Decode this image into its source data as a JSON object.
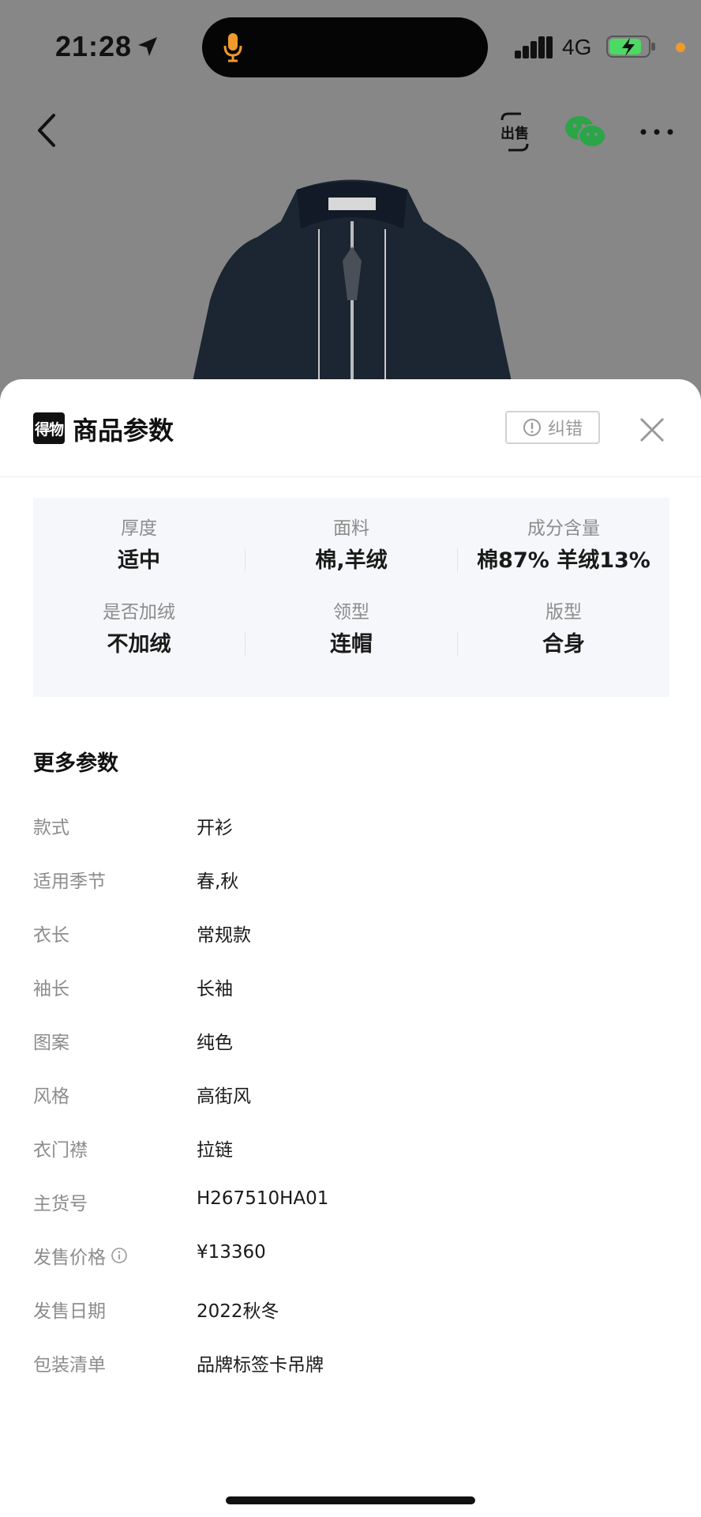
{
  "status_bar": {
    "time": "21:28",
    "network": "4G"
  },
  "nav": {
    "back_icon": "chevron-left-icon",
    "sell_label": "出售",
    "share_icon": "wechat-icon",
    "more_icon": "more-dots-icon"
  },
  "sheet": {
    "brand_logo_text": "得物",
    "title": "商品参数",
    "report_label": "纠错",
    "close_icon": "close-icon"
  },
  "key_params": [
    {
      "label": "厚度",
      "value": "适中"
    },
    {
      "label": "面料",
      "value": "棉,羊绒"
    },
    {
      "label": "成分含量",
      "value": "棉87%  羊绒13%"
    },
    {
      "label": "是否加绒",
      "value": "不加绒"
    },
    {
      "label": "领型",
      "value": "连帽"
    },
    {
      "label": "版型",
      "value": "合身"
    }
  ],
  "more_params": {
    "title": "更多参数",
    "rows": [
      {
        "key": "款式",
        "value": "开衫"
      },
      {
        "key": "适用季节",
        "value": "春,秋"
      },
      {
        "key": "衣长",
        "value": "常规款"
      },
      {
        "key": "袖长",
        "value": "长袖"
      },
      {
        "key": "图案",
        "value": "纯色"
      },
      {
        "key": "风格",
        "value": "高街风"
      },
      {
        "key": "衣门襟",
        "value": "拉链"
      },
      {
        "key": "主货号",
        "value": "H267510HA01"
      },
      {
        "key": "发售价格",
        "value": "¥13360"
      },
      {
        "key": "发售日期",
        "value": "2022秋冬"
      },
      {
        "key": "包装清单",
        "value": "品牌标签卡吊牌"
      }
    ]
  },
  "colors": {
    "overlay": "#878787",
    "card_bg": "#f6f7fa",
    "label_gray": "#8c8c8c",
    "text_dark": "#1a1a1a",
    "status_orange": "#f19a2c",
    "battery_green": "#4cd964"
  }
}
